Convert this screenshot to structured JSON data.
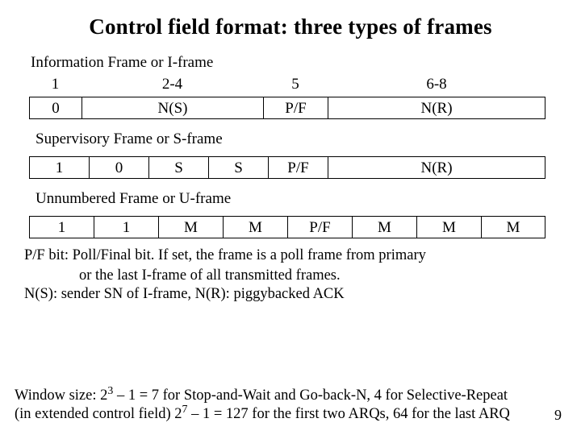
{
  "title": "Control field format: three types of frames",
  "iframe": {
    "label": "Information Frame or I-frame",
    "bits": [
      "1",
      "2-4",
      "5",
      "6-8"
    ],
    "cells": [
      "0",
      "N(S)",
      "P/F",
      "N(R)"
    ]
  },
  "sframe": {
    "label": "Supervisory Frame or S-frame",
    "cells": [
      "1",
      "0",
      "S",
      "S",
      "P/F",
      "N(R)"
    ]
  },
  "uframe": {
    "label": "Unnumbered Frame or U-frame",
    "cells": [
      "1",
      "1",
      "M",
      "M",
      "P/F",
      "M",
      "M",
      "M"
    ]
  },
  "notes": {
    "pf_line1": "P/F bit: Poll/Final bit. If set, the frame is a poll frame from primary",
    "pf_line2": "or the last I-frame of all transmitted frames.",
    "ns_nr": "N(S): sender SN of I-frame, N(R): piggybacked ACK"
  },
  "window": {
    "prefix": "Window size: 2",
    "exp1": "3",
    "mid1": " – 1 = 7 for Stop-and-Wait and Go-back-N, 4 for Selective-Repeat",
    "line2a": "(in extended control field) 2",
    "exp2": "7",
    "line2b": " – 1 = 127 for the first two ARQs, 64 for the last ARQ"
  },
  "page_number": "9"
}
